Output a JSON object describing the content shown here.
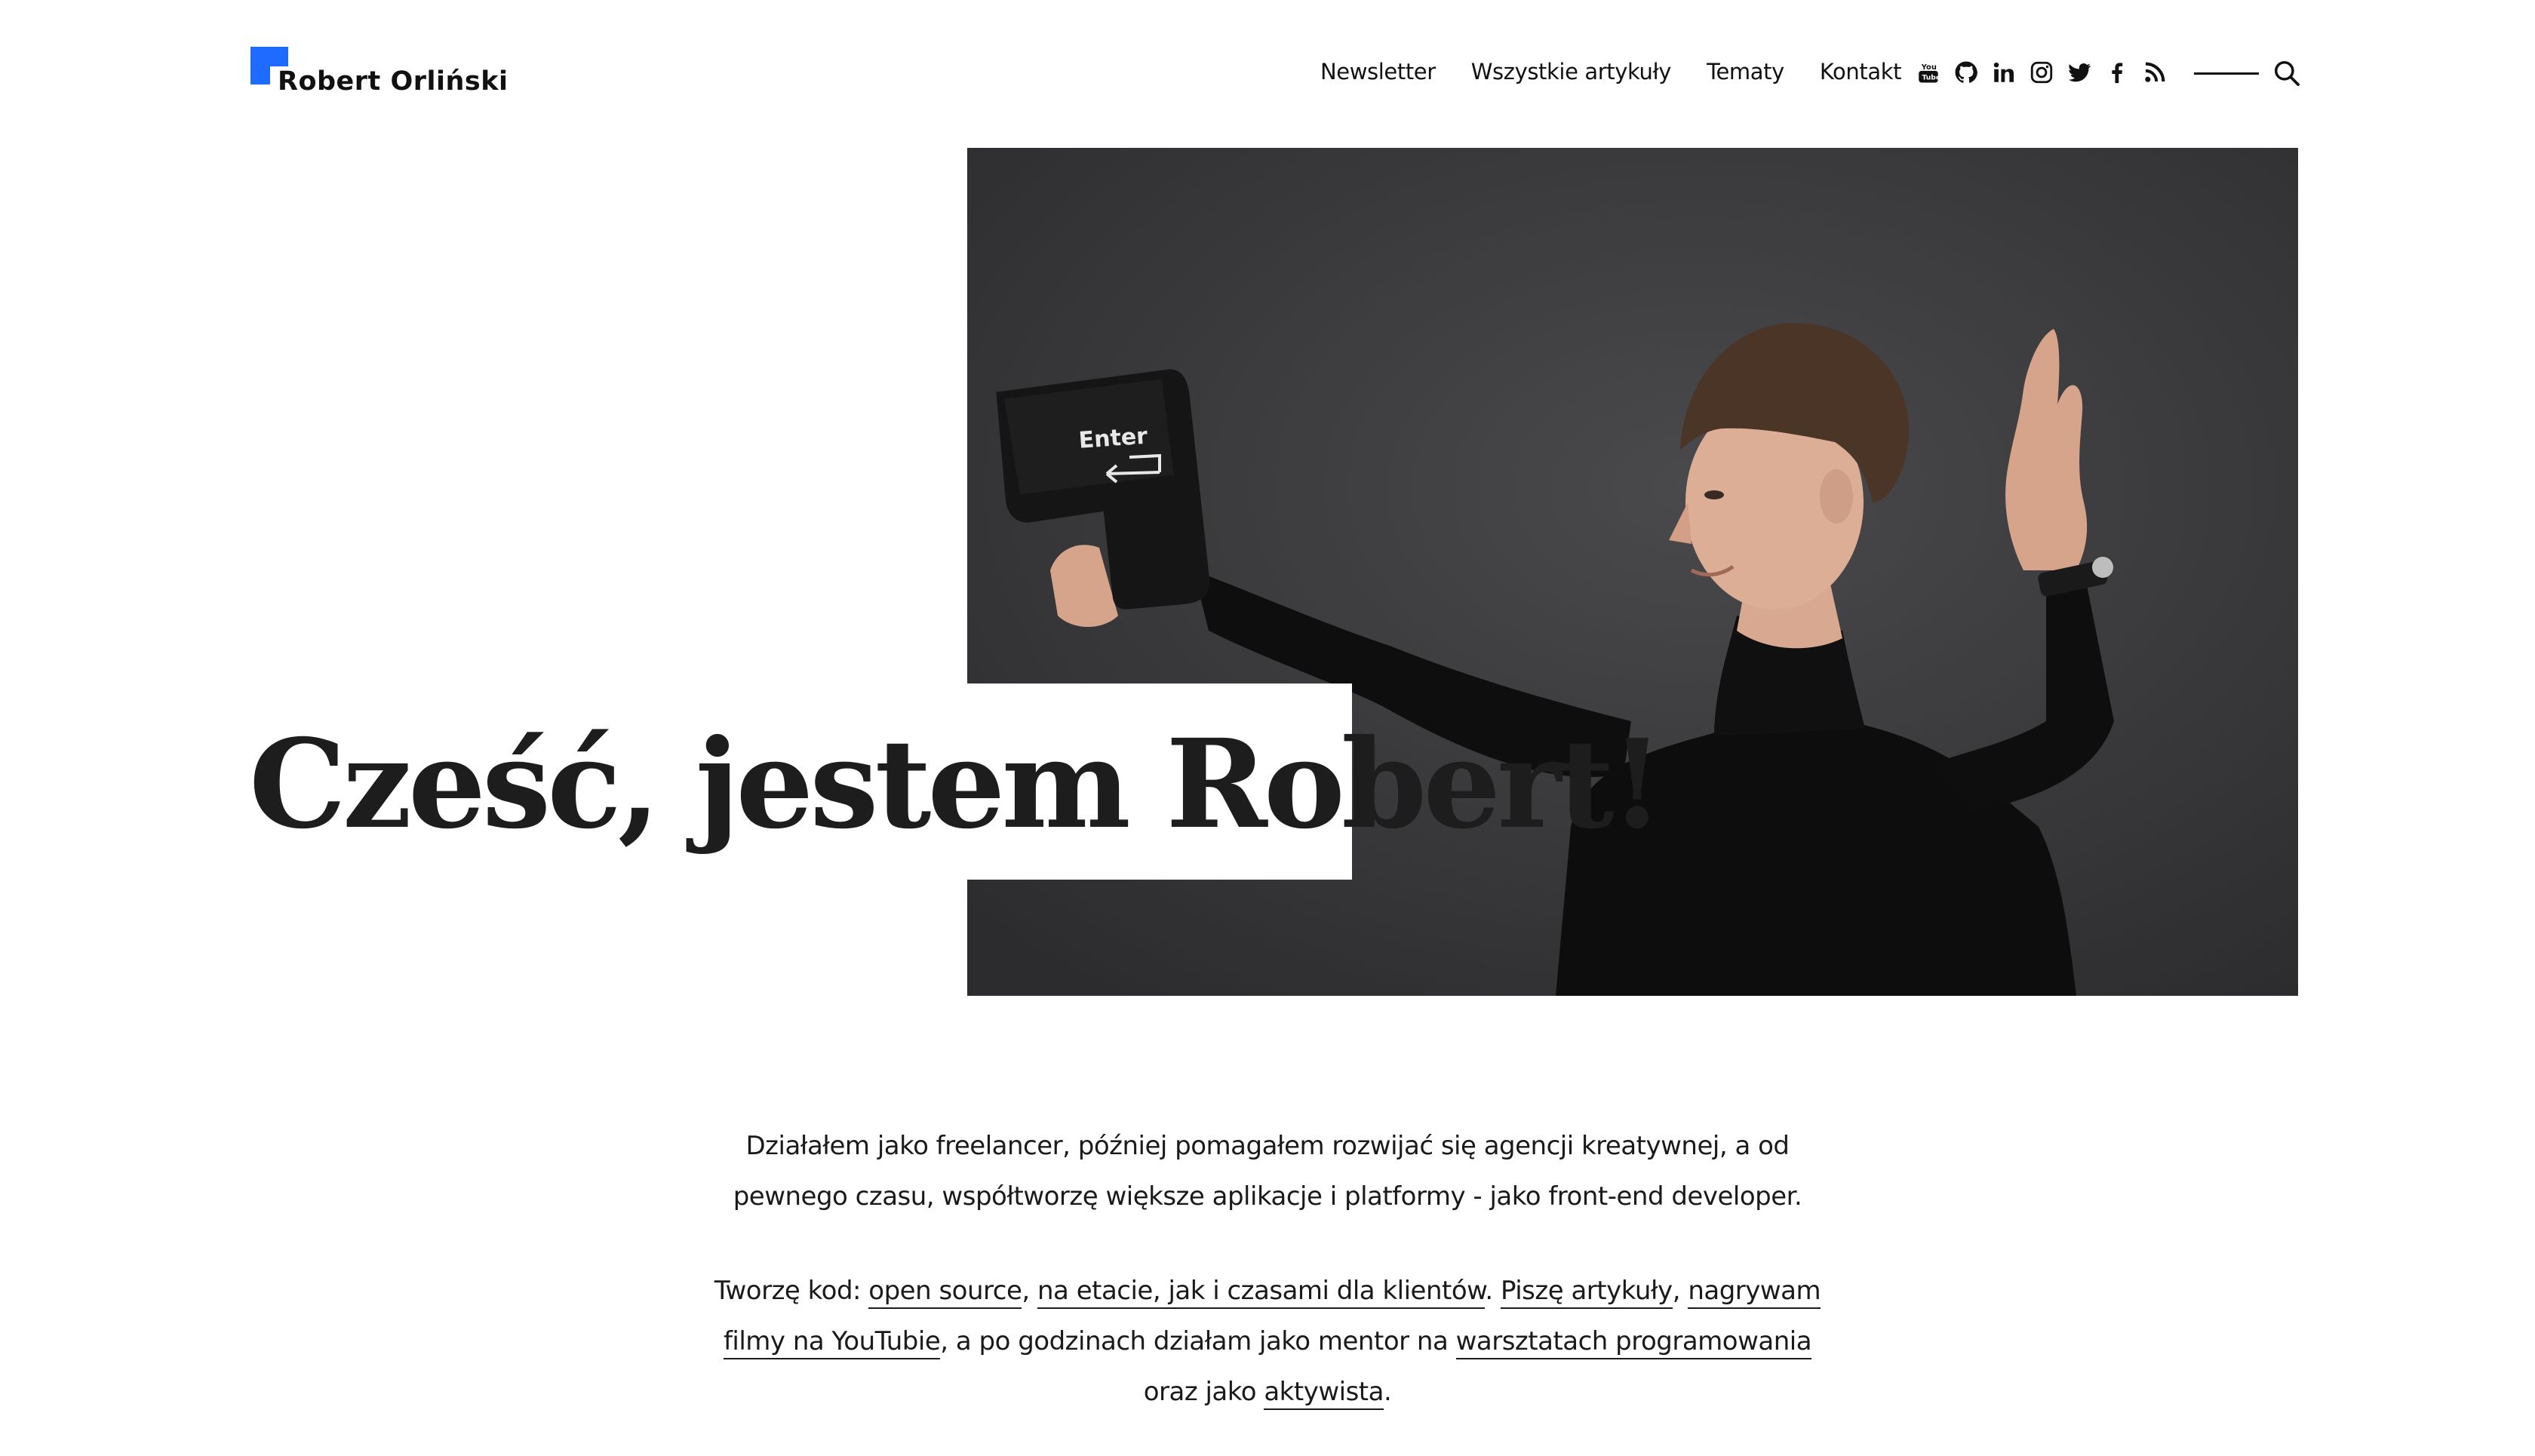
{
  "site": {
    "logo_text": "Robert Orliński",
    "brand_color": "#1f6bff"
  },
  "nav": {
    "items": [
      "Newsletter",
      "Wszystkie artykuły",
      "Tematy",
      "Kontakt"
    ]
  },
  "social": {
    "icons": [
      "youtube-icon",
      "github-icon",
      "linkedin-icon",
      "instagram-icon",
      "twitter-icon",
      "facebook-icon",
      "rss-icon"
    ]
  },
  "hero": {
    "title": "Cześć, jestem Robert!",
    "photo_key_label": "Enter"
  },
  "bio": {
    "p1": "Działałem jako freelancer, później pomagałem rozwijać się agencji kreatywnej, a od pewnego czasu, współtworzę większe aplikacje i platformy - jako front-end developer.",
    "p2_intro": "Tworzę kod: ",
    "link_open_source": "open source",
    "sep_comma": ", ",
    "link_job": "na etacie, jak i czasami dla klientów",
    "sep_period": ". ",
    "link_articles": "Piszę artykuły",
    "link_youtube": "nagrywam filmy na YouTubie",
    "p2_mid": ", a po godzinach działam jako mentor na ",
    "link_workshops": "warsztatach programowania",
    "p2_and": " oraz jako ",
    "link_activist": "aktywista",
    "p2_end": "."
  }
}
